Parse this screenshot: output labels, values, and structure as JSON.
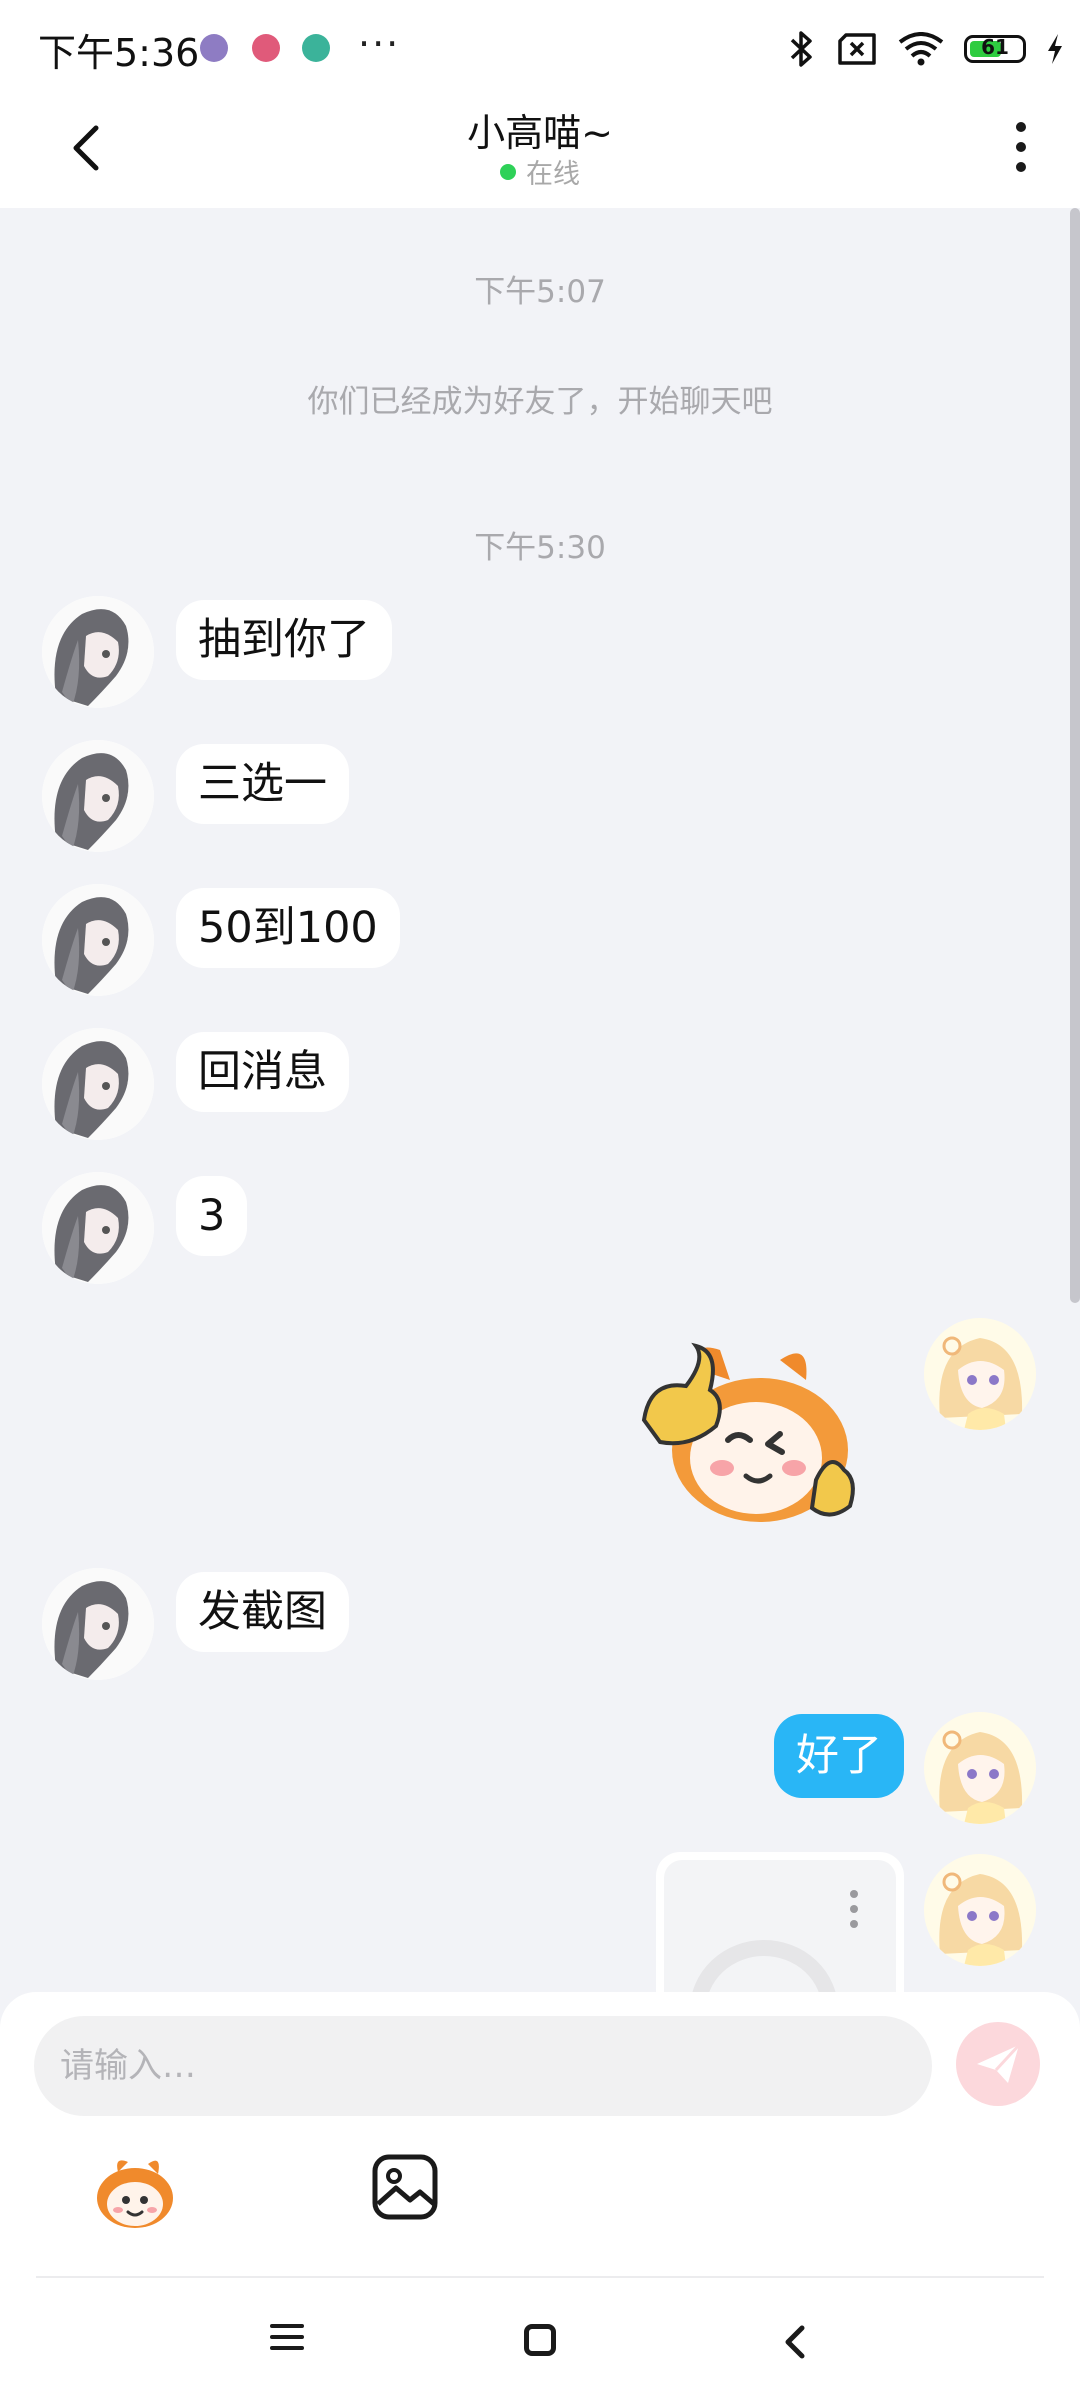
{
  "status_bar": {
    "time": "下午5:36",
    "more": "···",
    "battery_level": "61",
    "battery_fraction": 0.61
  },
  "header": {
    "title": "小高喵~",
    "status": "在线",
    "status_color": "#2ed158"
  },
  "chat": {
    "timestamps": [
      "下午5:07",
      "下午5:30"
    ],
    "system_message": "你们已经成为好友了，开始聊天吧",
    "messages": [
      {
        "from": "other",
        "text": "抽到你了"
      },
      {
        "from": "other",
        "text": "三选一"
      },
      {
        "from": "other",
        "text": "50到100"
      },
      {
        "from": "other",
        "text": "回消息"
      },
      {
        "from": "other",
        "text": "3"
      },
      {
        "from": "me",
        "sticker": "winking-mascot-sticker"
      },
      {
        "from": "other",
        "text": "发截图"
      },
      {
        "from": "me",
        "text": "好了"
      },
      {
        "from": "me",
        "image": "image-message"
      }
    ]
  },
  "input": {
    "placeholder": "请输入…"
  },
  "colors": {
    "outgoing_bubble": "#29b6f6",
    "incoming_bubble": "#ffffff",
    "background": "#f2f3f7",
    "send_button": "#fcd8dc"
  },
  "icons": [
    "back-icon",
    "more-icon",
    "bluetooth-icon",
    "sim-off-icon",
    "wifi-icon",
    "battery-icon",
    "charging-icon",
    "send-icon",
    "emoji-icon",
    "image-icon",
    "nav-menu-icon",
    "nav-home-icon",
    "nav-back-icon"
  ]
}
